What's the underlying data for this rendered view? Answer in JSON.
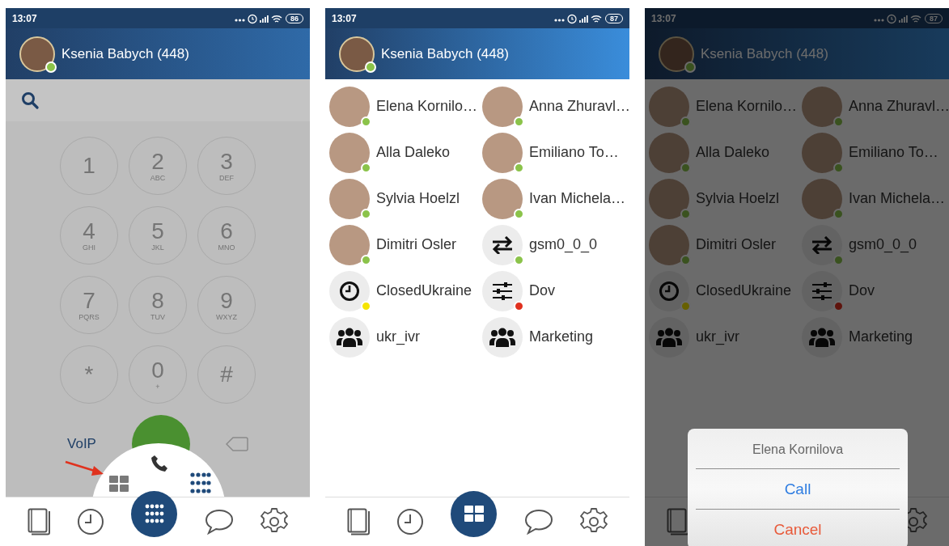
{
  "screens": [
    {
      "kind": "dialer",
      "status_bar": {
        "time": "13:07",
        "battery": "86"
      },
      "header": {
        "name": "Ksenia Babych (448)",
        "color": "#8bc34a"
      },
      "keypad": [
        {
          "digit": "1"
        },
        {
          "digit": "2",
          "letters": "ABC"
        },
        {
          "digit": "3",
          "letters": "DEF"
        },
        {
          "digit": "4",
          "letters": "GHI"
        },
        {
          "digit": "5",
          "letters": "JKL"
        },
        {
          "digit": "6",
          "letters": "MNO"
        },
        {
          "digit": "7",
          "letters": "PQRS"
        },
        {
          "digit": "8",
          "letters": "TUV"
        },
        {
          "digit": "9",
          "letters": "WXYZ"
        },
        {
          "digit": "*"
        },
        {
          "digit": "0",
          "letters": "+"
        },
        {
          "digit": "#"
        }
      ],
      "call_mode": "VoIP"
    },
    {
      "kind": "contacts",
      "status_bar": {
        "time": "13:07",
        "battery": "87"
      },
      "header": {
        "name": "Ksenia Babych (448)",
        "color": "#8bc34a"
      },
      "contacts": [
        {
          "name": "Elena Kornilo…",
          "kind": "photo",
          "color": "#8bc34a"
        },
        {
          "name": "Anna Zhuravl…",
          "kind": "photo",
          "color": "#8bc34a"
        },
        {
          "name": "Alla Daleko",
          "kind": "photo",
          "color": "#8bc34a"
        },
        {
          "name": "Emiliano To…",
          "kind": "photo",
          "color": "#8bc34a"
        },
        {
          "name": "Sylvia Hoelzl",
          "kind": "photo",
          "color": "#8bc34a"
        },
        {
          "name": "Ivan Michela…",
          "kind": "photo",
          "color": "#8bc34a"
        },
        {
          "name": "Dimitri Osler",
          "kind": "photo",
          "color": "#8bc34a"
        },
        {
          "name": "gsm0_0_0",
          "kind": "trunk",
          "color": "#8bc34a"
        },
        {
          "name": "ClosedUkraine",
          "kind": "schedule",
          "color": "#f5e400"
        },
        {
          "name": "Dov",
          "kind": "settings",
          "color": "#e0301e"
        },
        {
          "name": "ukr_ivr",
          "kind": "group"
        },
        {
          "name": "Marketing",
          "kind": "group"
        }
      ]
    },
    {
      "kind": "contacts",
      "status_bar": {
        "time": "13:07",
        "battery": "87"
      },
      "header": {
        "name": "Ksenia Babych (448)",
        "color": "#3a521f"
      },
      "contacts": [
        {
          "name": "Elena Kornilo…",
          "kind": "photo",
          "color": "#3a521f"
        },
        {
          "name": "Anna Zhuravl…",
          "kind": "photo",
          "color": "#3a521f"
        },
        {
          "name": "Alla Daleko",
          "kind": "photo",
          "color": "#3a521f"
        },
        {
          "name": "Emiliano To…",
          "kind": "photo",
          "color": "#3a521f"
        },
        {
          "name": "Sylvia Hoelzl",
          "kind": "photo",
          "color": "#3a521f"
        },
        {
          "name": "Ivan Michela…",
          "kind": "photo",
          "color": "#3a521f"
        },
        {
          "name": "Dimitri Osler",
          "kind": "photo",
          "color": "#3a521f"
        },
        {
          "name": "gsm0_0_0",
          "kind": "trunk",
          "color": "#3a521f"
        },
        {
          "name": "ClosedUkraine",
          "kind": "schedule",
          "color": "#676000"
        },
        {
          "name": "Dov",
          "kind": "settings",
          "color": "#5e140d"
        },
        {
          "name": "ukr_ivr",
          "kind": "group"
        },
        {
          "name": "Marketing",
          "kind": "group"
        }
      ],
      "dialog": {
        "title": "Elena Kornilova",
        "buttons": [
          {
            "label": "Call",
            "kind": "confirm"
          },
          {
            "label": "Cancel",
            "kind": "cancel"
          }
        ]
      }
    }
  ]
}
